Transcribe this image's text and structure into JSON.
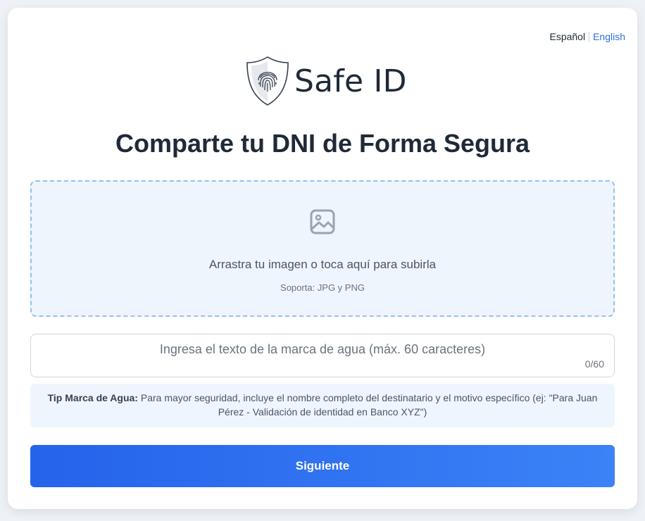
{
  "language": {
    "current": "Español",
    "other": "English"
  },
  "logo": {
    "text": "Safe ID",
    "icon": "shield-fingerprint-icon"
  },
  "title": "Comparte tu DNI de Forma Segura",
  "upload": {
    "icon": "image-icon",
    "main_text": "Arrastra tu imagen o toca aquí para subirla",
    "sub_text": "Soporta: JPG y PNG"
  },
  "watermark": {
    "placeholder": "Ingresa el texto de la marca de agua (máx. 60 caracteres)",
    "value": "",
    "counter": "0/60"
  },
  "tip": {
    "label": "Tip Marca de Agua:",
    "text": " Para mayor seguridad, incluye el nombre completo del destinatario y el motivo específico (ej: \"Para Juan Pérez - Validación de identidad en Banco XYZ\")"
  },
  "next_button": "Siguiente",
  "colors": {
    "accent": "#2563eb",
    "link": "#2f6fd8",
    "dropzone_bg": "#eef5fd",
    "dropzone_border": "#93c2ea"
  }
}
